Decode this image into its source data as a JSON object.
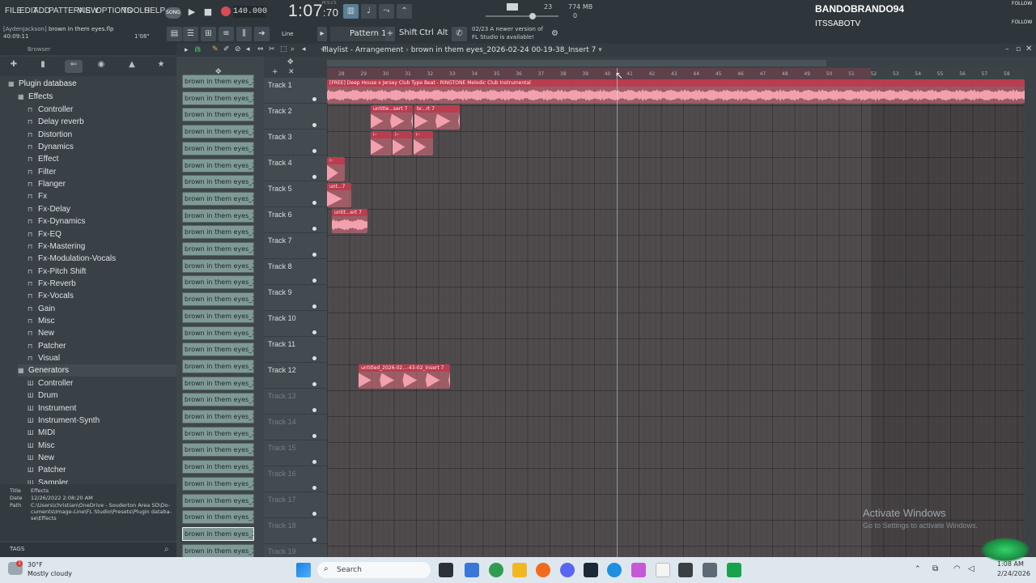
{
  "menu": {
    "items": [
      "FILE",
      "EDIT",
      "ADD",
      "PATTERNS",
      "VIEW",
      "OPTIONS",
      "TOOLS",
      "HELP"
    ]
  },
  "transport": {
    "song_mode_label": "SONG",
    "tempo": "140.000",
    "time_main": "1:07",
    "time_sub": ":70",
    "time_label": "M:S:CS",
    "cpu": "23",
    "memory": "774 MB",
    "memory_sub": "0"
  },
  "stream": {
    "user_name": "BANDOBRANDO94",
    "channel": "ITSSABOTV",
    "follow_label": "FOLLOW"
  },
  "toolbar2": {
    "author": "[AydenJackson]",
    "project_file": "brown in them eyes.flp",
    "project_time": "40:09:11",
    "project_duration": "1'08\"",
    "snap": "Line",
    "pattern": "Pattern 1",
    "mod_shift": "Shift",
    "mod_ctrl": "Ctrl",
    "mod_alt": "Alt",
    "news_date": "02/23",
    "news_line1": "A newer version of",
    "news_line2": "FL Studio is available!"
  },
  "browser": {
    "header": "Browser",
    "root": "Plugin database",
    "effects_folder": "Effects",
    "effects": [
      "Controller",
      "Delay reverb",
      "Distortion",
      "Dynamics",
      "Effect",
      "Filter",
      "Flanger",
      "Fx",
      "Fx-Delay",
      "Fx-Dynamics",
      "Fx-EQ",
      "Fx-Mastering",
      "Fx-Modulation-Vocals",
      "Fx-Pitch Shift",
      "Fx-Reverb",
      "Fx-Vocals",
      "Gain",
      "Misc",
      "New",
      "Patcher",
      "Visual"
    ],
    "generators_folder": "Generators",
    "generators": [
      "Controller",
      "Drum",
      "Instrument",
      "Instrument-Synth",
      "MIDI",
      "Misc",
      "New",
      "Patcher",
      "Sampler"
    ],
    "info": {
      "title_label": "Title",
      "title_value": "Effects",
      "date_label": "Date",
      "date_value": "12/26/2022 2:08:20 AM",
      "path_label": "Path",
      "path_value_1": "C:\\Users\\christian\\OneDrive - Souderton Area SD\\Do-",
      "path_value_2": "cuments\\Image-Line\\FL Studio\\Presets\\Plugin databa-",
      "path_value_3": "se\\Effects"
    },
    "tags_label": "TAGS"
  },
  "clip_list": {
    "items": [
      "brown in them eyes_202...",
      "brown in them eyes_202...",
      "brown in them eyes_202...",
      "brown in them eyes_202...",
      "brown in them eyes_202...",
      "brown in them eyes_202...",
      "brown in them eyes_202...",
      "brown in them eyes_202...",
      "brown in them eyes_202...",
      "brown in them eyes_202...",
      "brown in them eyes_202...",
      "brown in them eyes_202...",
      "brown in them eyes_202...",
      "brown in them eyes_202...",
      "brown in them eyes_202...",
      "brown in them eyes_202...",
      "brown in them eyes_202...",
      "brown in them eyes_202...",
      "brown in them eyes_202...",
      "brown in them eyes_202...",
      "brown in them eyes_202...",
      "brown in them eyes_202...",
      "brown in them eyes_202...",
      "brown in them eyes_202...",
      "brown in them eyes_202...",
      "brown in them eyes_202...",
      "brown in them eyes_202...",
      "brown in them eyes_202...",
      "brown in them eyes_202..."
    ]
  },
  "playlist": {
    "title": "Playlist - Arrangement",
    "arrangement": "brown in them eyes_2026-02-24 00-19-38_Insert 7",
    "tracks": [
      "Track 1",
      "Track 2",
      "Track 3",
      "Track 4",
      "Track 5",
      "Track 6",
      "Track 7",
      "Track 8",
      "Track 9",
      "Track 10",
      "Track 11",
      "Track 12",
      "Track 13",
      "Track 14",
      "Track 15",
      "Track 16",
      "Track 17",
      "Track 18",
      "Track 19"
    ],
    "bar_numbers": [
      "28",
      "29",
      "30",
      "31",
      "32",
      "33",
      "34",
      "35",
      "36",
      "37",
      "38",
      "39",
      "40",
      "41",
      "42",
      "43",
      "44",
      "45",
      "46",
      "47",
      "48",
      "49",
      "50",
      "51",
      "52",
      "53",
      "54",
      "55",
      "56",
      "57",
      "58"
    ],
    "clips": {
      "main": "[FREE] Deep House x Jersey Club Type Beat - RINGTONE Melodic Club Instrumental",
      "t2a": "untitle...sert 7",
      "t2b": "br...rt 7",
      "t6": "untit...ert 7",
      "t5": "unt...7",
      "t12": "untitled_2026-02...-43-02_Insert 7"
    }
  },
  "system": {
    "activate_title": "Activate Windows",
    "activate_sub": "Go to Settings to activate Windows.",
    "weather_temp": "30°F",
    "weather_desc": "Mostly cloudy",
    "search": "Search",
    "notif_count": "1",
    "clock_time": "1:08 AM",
    "clock_date": "2/24/2026"
  },
  "colors": {
    "clip_header": "#b93d4f",
    "clip_body": "#de6e7d",
    "accent_green": "#3fbf6b",
    "record_red": "#d94b55"
  }
}
